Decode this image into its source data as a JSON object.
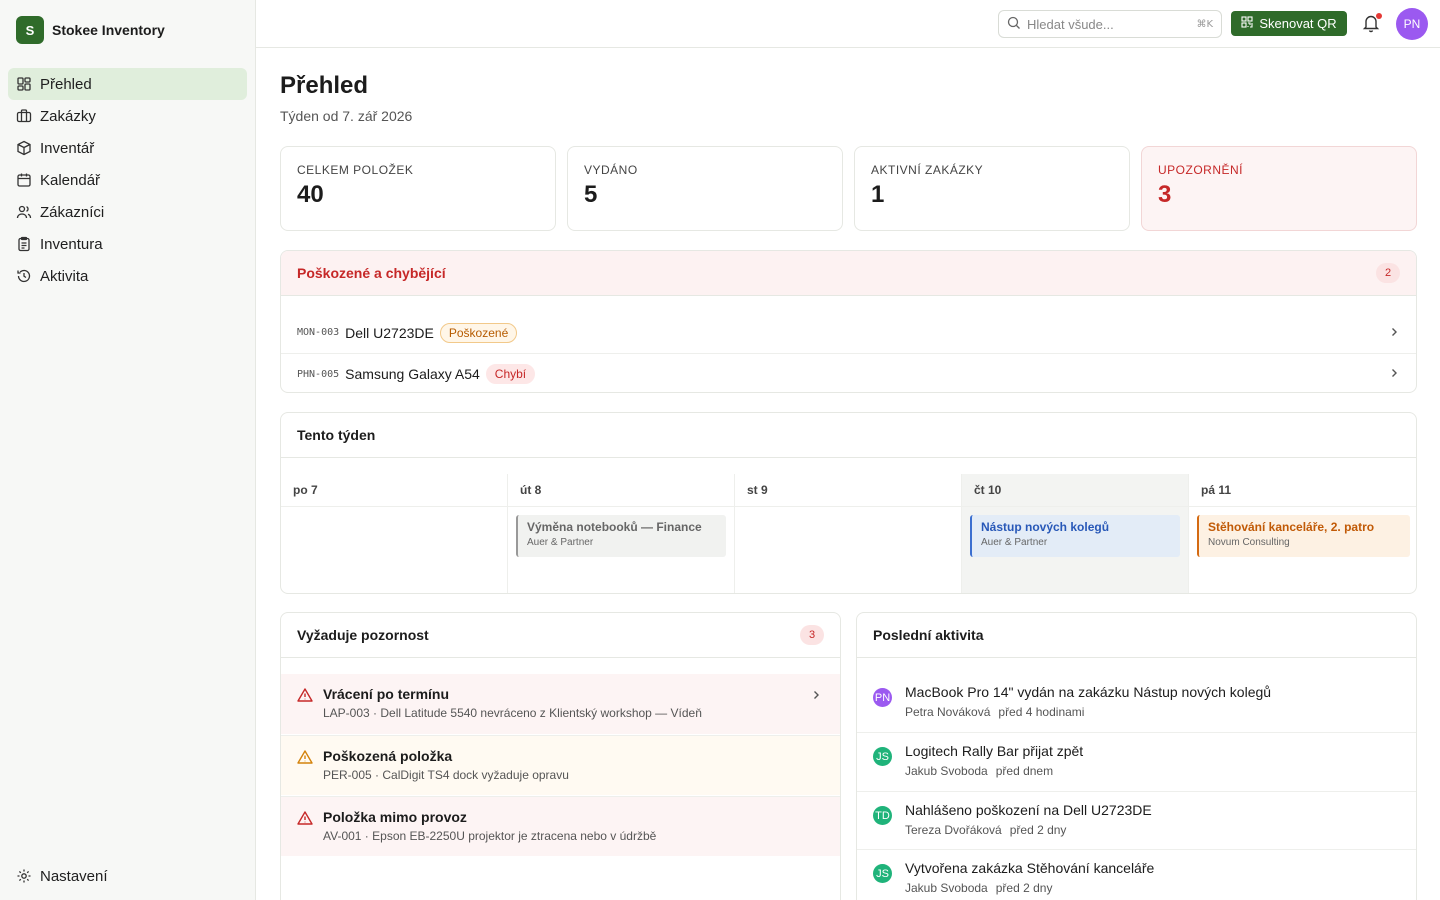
{
  "app": {
    "logo_letter": "S",
    "name": "Stokee Inventory"
  },
  "sidebar": {
    "items": [
      {
        "label": "Přehled",
        "icon": "dashboard-icon",
        "active": true
      },
      {
        "label": "Zakázky",
        "icon": "briefcase-icon"
      },
      {
        "label": "Inventář",
        "icon": "box-icon"
      },
      {
        "label": "Kalendář",
        "icon": "calendar-icon"
      },
      {
        "label": "Zákazníci",
        "icon": "users-icon"
      },
      {
        "label": "Inventura",
        "icon": "clipboard-icon"
      },
      {
        "label": "Aktivita",
        "icon": "history-icon"
      }
    ],
    "settings_label": "Nastavení"
  },
  "topbar": {
    "search_placeholder": "Hledat všude...",
    "search_shortcut": "⌘K",
    "scan_label": "Skenovat QR",
    "user_initials": "PN",
    "accent": "#2f6b2a"
  },
  "page": {
    "title": "Přehled",
    "subtitle": "Týden od 7. zář 2026"
  },
  "stats": [
    {
      "label": "Celkem položek",
      "value": "40"
    },
    {
      "label": "Vydáno",
      "value": "5"
    },
    {
      "label": "Aktivní zakázky",
      "value": "1"
    },
    {
      "label": "Upozornění",
      "value": "3"
    }
  ],
  "damaged": {
    "title": "Poškozené a chybějící",
    "count": "2",
    "items": [
      {
        "code": "MON-003",
        "name": "Dell U2723DE",
        "status": "Poškozené"
      },
      {
        "code": "PHN-005",
        "name": "Samsung Galaxy A54",
        "status": "Chybí"
      }
    ]
  },
  "week": {
    "title": "Tento týden",
    "days": [
      {
        "label": "po 7"
      },
      {
        "label": "út 8",
        "event": {
          "title": "Výměna notebooků — Finance",
          "client": "Auer & Partner"
        }
      },
      {
        "label": "st 9"
      },
      {
        "label": "čt 10",
        "today": true,
        "event": {
          "title": "Nástup nových kolegů",
          "client": "Auer & Partner"
        }
      },
      {
        "label": "pá 11",
        "event": {
          "title": "Stěhování kanceláře, 2. patro",
          "client": "Novum Consulting"
        }
      }
    ]
  },
  "attention": {
    "title": "Vyžaduje pozornost",
    "count": "3",
    "items": [
      {
        "title": "Vrácení po termínu",
        "detail": "LAP-003 · Dell Latitude 5540 nevráceno z Klientský workshop — Vídeň"
      },
      {
        "title": "Poškozená položka",
        "detail": "PER-005 · CalDigit TS4 dock vyžaduje opravu"
      },
      {
        "title": "Položka mimo provoz",
        "detail": "AV-001 · Epson EB-2250U projektor je ztracena nebo v údržbě"
      }
    ]
  },
  "activity": {
    "title": "Poslední aktivita",
    "items": [
      {
        "initials": "PN",
        "color": "#9b59f0",
        "text": "MacBook Pro 14\" vydán na zakázku Nástup nových kolegů",
        "user": "Petra Nováková",
        "time": "před 4 hodinami"
      },
      {
        "initials": "JS",
        "color": "#1fb37a",
        "text": "Logitech Rally Bar přijat zpět",
        "user": "Jakub Svoboda",
        "time": "před dnem"
      },
      {
        "initials": "TD",
        "color": "#1fb37a",
        "text": "Nahlášeno poškození na Dell U2723DE",
        "user": "Tereza Dvořáková",
        "time": "před 2 dny"
      },
      {
        "initials": "JS",
        "color": "#1fb37a",
        "text": "Vytvořena zakázka Stěhování kanceláře",
        "user": "Jakub Svoboda",
        "time": "před 2 dny"
      }
    ]
  }
}
